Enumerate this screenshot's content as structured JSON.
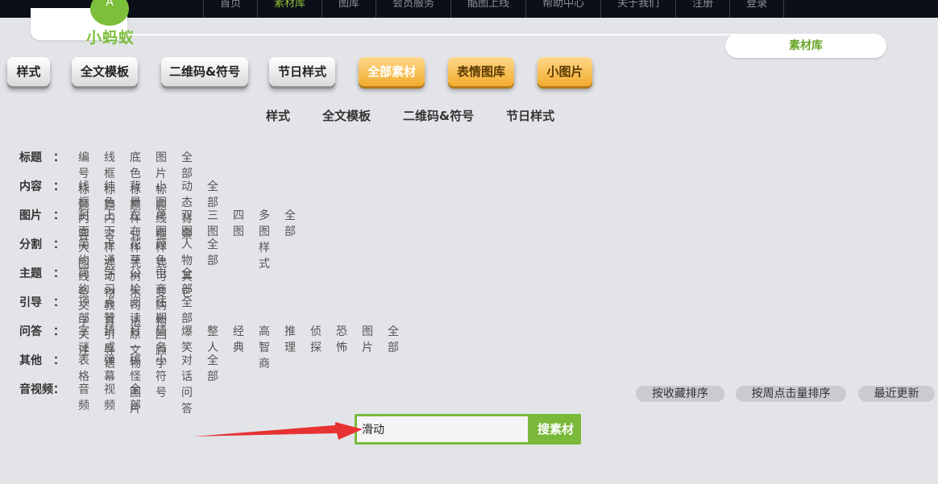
{
  "top_nav": {
    "items": [
      {
        "label": "首页"
      },
      {
        "label": "素材库",
        "active": true
      },
      {
        "label": "图库"
      },
      {
        "label": "会员服务"
      },
      {
        "label": "酷图上线"
      },
      {
        "label": "帮助中心"
      },
      {
        "label": "关于我们"
      },
      {
        "label": "注册"
      },
      {
        "label": "登录"
      }
    ]
  },
  "logo": {
    "text": "小蚂蚁",
    "glyph": "A"
  },
  "section_badge": "素材库",
  "main_tabs": [
    "样式",
    "全文模板",
    "二维码&符号",
    "节日样式",
    "全部素材",
    "表情图库",
    "小图片"
  ],
  "sub_tabs": [
    "样式",
    "全文模板",
    "二维码&符号",
    "节日样式"
  ],
  "categories": [
    {
      "label": "标题",
      "colon": "：",
      "items": [
        "编号标题",
        "线框标题",
        "底色标题",
        "图片标题",
        "全部"
      ]
    },
    {
      "label": "内容",
      "colon": "：",
      "items": [
        "线框内容",
        "纯色内容",
        "背景样式",
        "小图线框",
        "动态背景",
        "全部"
      ]
    },
    {
      "label": "图片",
      "colon": "：",
      "items": [
        "封面大图",
        "上下样式",
        "左右样式",
        "单图样式",
        "双图",
        "三图",
        "四图",
        "多图样式",
        "全部"
      ]
    },
    {
      "label": "分割",
      "colon": "：",
      "items": [
        "简约线条",
        "卡通动物",
        "花草树木",
        "颜色可变",
        "人物其它",
        "全部"
      ]
    },
    {
      "label": "主题",
      "colon": "：",
      "items": [
        "简约文字",
        "学习教育",
        "公检司法",
        "电商购物",
        "全部"
      ]
    },
    {
      "label": "引导",
      "colon": "：",
      "items": [
        "顶部关注",
        "点赞引导",
        "阅读原文",
        "往期回顾",
        "全部"
      ]
    },
    {
      "label": "问答",
      "colon": "：",
      "items": [
        "字谜",
        "猜成语",
        "打一物",
        "猜名字",
        "爆笑",
        "整人",
        "经典",
        "高智商",
        "推理",
        "侦探",
        "恐怖",
        "图片",
        "全部"
      ]
    },
    {
      "label": "其他",
      "colon": "：",
      "items": [
        "表格",
        "弹幕",
        "搞怪图片",
        "小符号",
        "对话问答",
        "全部"
      ]
    },
    {
      "label": "音视频",
      "colon": "：",
      "items": [
        "音频",
        "视频",
        "全部"
      ]
    }
  ],
  "sort_buttons": [
    "按收藏排序",
    "按周点击量排序",
    "最近更新"
  ],
  "search": {
    "value": "滑动",
    "button_label": "搜素材"
  },
  "colors": {
    "accent_green": "#7ab93a",
    "orange": "#f2ac2e",
    "topbar": "#0b0f18",
    "arrow": "#e63232"
  }
}
